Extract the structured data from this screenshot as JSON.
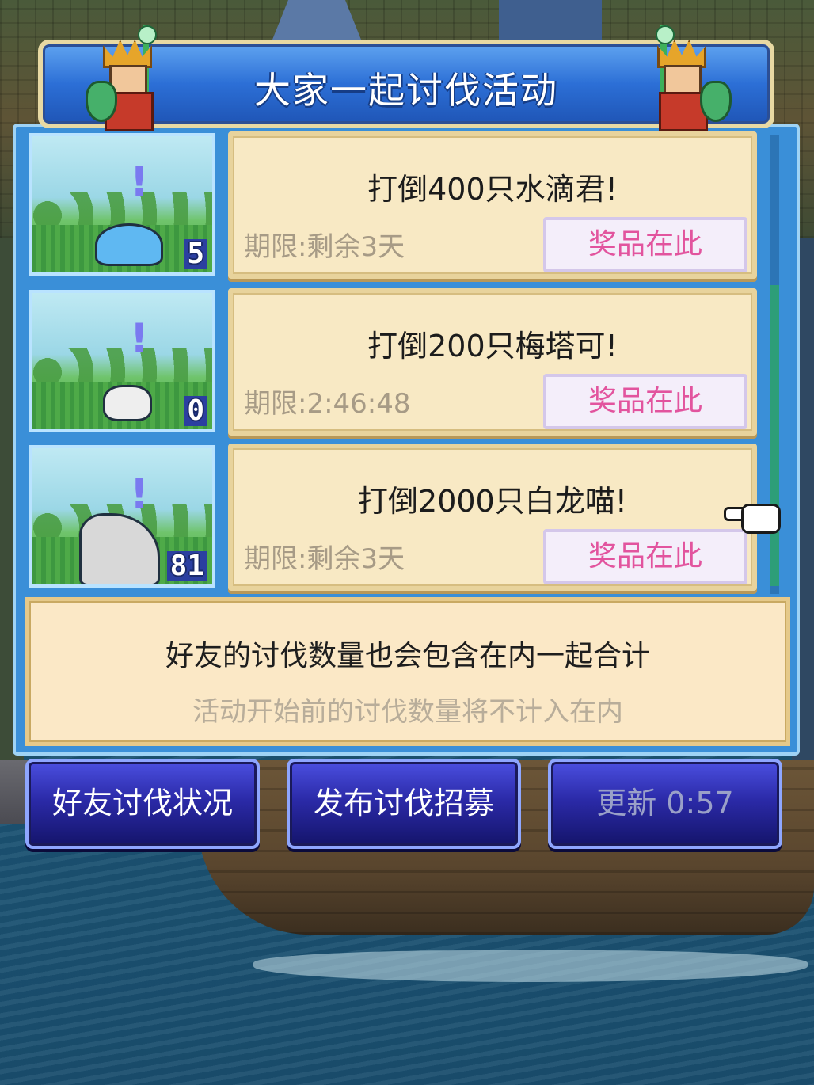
{
  "header": {
    "title": "大家一起讨伐活动"
  },
  "quests": [
    {
      "title": "打倒400只水滴君!",
      "deadline": "期限:剩余3天",
      "prize_label": "奖品在此",
      "count": "5",
      "monster_icon": "water-drop-monster"
    },
    {
      "title": "打倒200只梅塔可!",
      "deadline": "期限:2:46:48",
      "prize_label": "奖品在此",
      "count": "0",
      "monster_icon": "cat-monster"
    },
    {
      "title": "打倒2000只白龙喵!",
      "deadline": "期限:剩余3天",
      "prize_label": "奖品在此",
      "count": "81",
      "monster_icon": "white-dragon-monster"
    }
  ],
  "info": {
    "main": "好友的讨伐数量也会包含在内一起合计",
    "sub": "活动开始前的讨伐数量将不计入在内"
  },
  "buttons": {
    "friends_status": "好友讨伐状况",
    "post_recruit": "发布讨伐招募",
    "refresh": "更新 0:57"
  },
  "colors": {
    "banner_blue": "#2c6fd6",
    "card_bg": "#f8e9c4",
    "prize_text": "#e2549e",
    "button_blue": "#2b2aa8"
  }
}
